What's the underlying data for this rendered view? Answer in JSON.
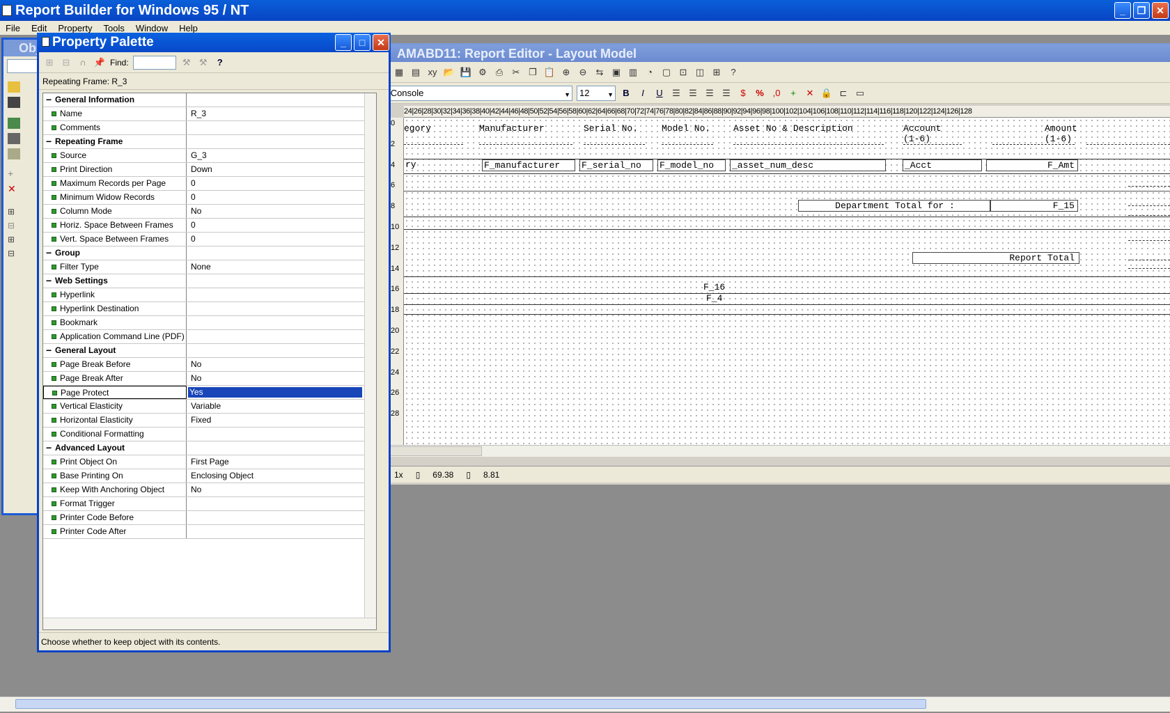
{
  "app": {
    "title": "Report Builder for Windows 95 / NT"
  },
  "menu": [
    "File",
    "Edit",
    "Property",
    "Tools",
    "Window",
    "Help"
  ],
  "objnav": {
    "title": "Obj"
  },
  "palette": {
    "title": "Property Palette",
    "find_label": "Find:",
    "find_value": "",
    "header": "Repeating Frame: R_3",
    "status": "Choose whether to keep object with its contents.",
    "rows": [
      {
        "section": true,
        "name": "General Information",
        "value": ""
      },
      {
        "name": "Name",
        "value": "R_3"
      },
      {
        "name": "Comments",
        "value": ""
      },
      {
        "section": true,
        "name": "Repeating Frame",
        "value": ""
      },
      {
        "name": "Source",
        "value": "G_3"
      },
      {
        "name": "Print Direction",
        "value": "Down"
      },
      {
        "name": "Maximum Records per Page",
        "value": "0"
      },
      {
        "name": "Minimum Widow Records",
        "value": "0"
      },
      {
        "name": "Column Mode",
        "value": "No"
      },
      {
        "name": "Horiz. Space Between Frames",
        "value": "0"
      },
      {
        "name": "Vert. Space Between Frames",
        "value": "0"
      },
      {
        "section": true,
        "name": "Group",
        "value": ""
      },
      {
        "name": "Filter Type",
        "value": "None"
      },
      {
        "section": true,
        "name": "Web Settings",
        "value": ""
      },
      {
        "name": "Hyperlink",
        "value": ""
      },
      {
        "name": "Hyperlink Destination",
        "value": ""
      },
      {
        "name": "Bookmark",
        "value": ""
      },
      {
        "name": "Application Command Line (PDF)",
        "value": ""
      },
      {
        "section": true,
        "name": "General Layout",
        "value": ""
      },
      {
        "name": "Page Break Before",
        "value": "No"
      },
      {
        "name": "Page Break After",
        "value": "No"
      },
      {
        "name": "Page Protect",
        "value": "Yes",
        "selected": true
      },
      {
        "name": "Vertical Elasticity",
        "value": "Variable"
      },
      {
        "name": "Horizontal Elasticity",
        "value": "Fixed"
      },
      {
        "name": "Conditional Formatting",
        "value": ""
      },
      {
        "section": true,
        "name": "Advanced Layout",
        "value": ""
      },
      {
        "name": "Print Object On",
        "value": "First Page"
      },
      {
        "name": "Base Printing On",
        "value": "Enclosing Object"
      },
      {
        "name": "Keep With Anchoring Object",
        "value": "No"
      },
      {
        "name": "Format Trigger",
        "value": ""
      },
      {
        "name": "Printer Code Before",
        "value": ""
      },
      {
        "name": "Printer Code After",
        "value": ""
      }
    ]
  },
  "editor": {
    "title": "AMABD11: Report Editor - Layout Model",
    "font": "ucida Console",
    "size": "12",
    "ruler_top": "24|26|28|30|32|34|36|38|40|42|44|46|48|50|52|54|56|58|60|62|64|66|68|70|72|74|76|78|80|82|84|86|88|90|92|94|96|98|100|102|104|106|108|110|112|114|116|118|120|122|124|126|128",
    "ruler_left": [
      "0",
      "2",
      "4",
      "6",
      "8",
      "10",
      "12",
      "14",
      "16",
      "18",
      "20",
      "22",
      "24",
      "26",
      "28"
    ],
    "headers": {
      "category": "egory",
      "manufacturer": "Manufacturer",
      "serial": "Serial No.",
      "model": "Model No.",
      "asset": "Asset No & Description",
      "account": "Account\n(1-6)",
      "amount": "Amount\n(1-6)"
    },
    "fields": {
      "cat": "ry",
      "manufacturer": "F_manufacturer",
      "serial": "F_serial_no",
      "model": "F_model_no",
      "asset": "_asset_num_desc",
      "acct": "_Acct",
      "amt": "F_Amt"
    },
    "dept_total": "Department Total for :",
    "f15": "F_15",
    "report_total": "Report Total",
    "f16": "F_16",
    "f4": "F_4",
    "status_zoom": "1x",
    "status_x": "69.38",
    "status_y": "8.81"
  }
}
